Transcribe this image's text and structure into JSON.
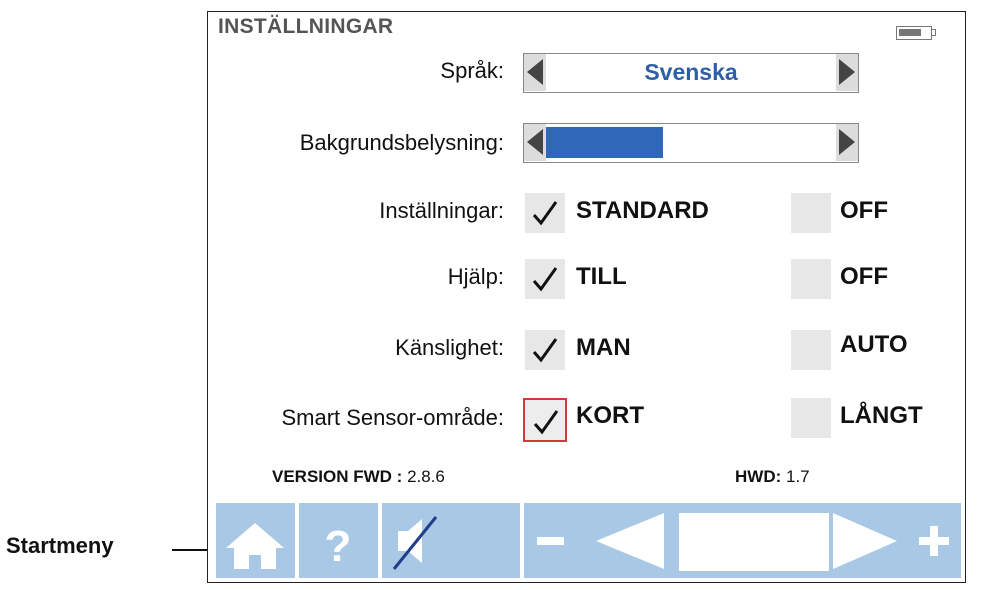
{
  "callout": {
    "label": "Startmeny"
  },
  "screen": {
    "title": "INSTÄLLNINGAR",
    "battery_icon": "battery-icon",
    "language": {
      "label": "Språk:",
      "value": "Svenska"
    },
    "backlight": {
      "label": "Bakgrundsbelysning:",
      "level_fraction": 0.4
    },
    "settings_rows": [
      {
        "label": "Inställningar:",
        "option_a": "STANDARD",
        "option_b": "OFF",
        "selected": "a"
      },
      {
        "label": "Hjälp:",
        "option_a": "TILL",
        "option_b": "OFF",
        "selected": "a"
      },
      {
        "label": "Känslighet:",
        "option_a": "MAN",
        "option_b": "AUTO",
        "selected": "a"
      },
      {
        "label": "Smart Sensor-område:",
        "option_a": "KORT",
        "option_b": "LÅNGT",
        "selected": "a",
        "focused": true
      }
    ],
    "version_fwd": {
      "label": "VERSION FWD :",
      "value": "2.8.6"
    },
    "version_hwd": {
      "label": "HWD:",
      "value": "1.7"
    }
  },
  "toolbar": {
    "icons": [
      "home-icon",
      "help-icon",
      "mute-icon",
      "minus-icon",
      "left-arrow-icon",
      "right-arrow-icon",
      "plus-icon"
    ]
  },
  "colors": {
    "accent_blue": "#2f68b8",
    "button_blue": "#a9c8e5",
    "focus_red": "#d03a3a",
    "value_blue": "#2e5fa6"
  }
}
